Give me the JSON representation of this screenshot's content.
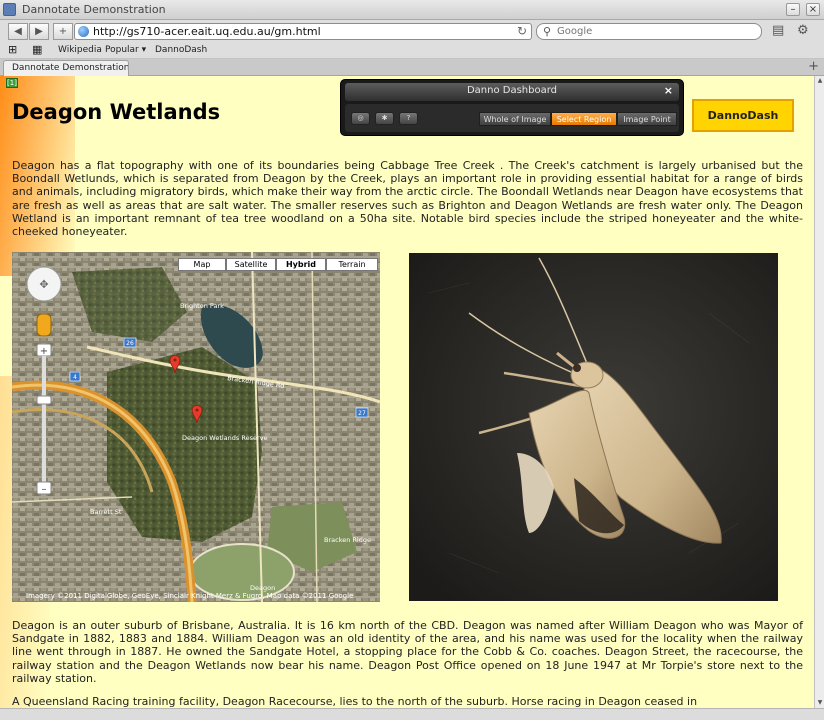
{
  "window": {
    "title": "Dannotate Demonstration"
  },
  "toolbar": {
    "back": "◀",
    "forward": "▶",
    "add": "+",
    "url": "http://gs710-acer.eait.uq.edu.au/gm.html",
    "reload": "↻",
    "search_placeholder": "Google"
  },
  "bookmarks": {
    "items": [
      "Wikipedia",
      "Popular ▾",
      "DannoDash"
    ]
  },
  "tab": {
    "label": "Dannotate Demonstration"
  },
  "page": {
    "badge": "[1]",
    "heading": "Deagon Wetlands",
    "para1": "Deagon has a flat topography with one of its boundaries being Cabbage Tree Creek . The Creek's catchment is largely urbanised but the Boondall Wetlunds, which is separated from Deagon by the Creek, plays an important role in providing essential habitat for a range of birds and animals, including migratory birds, which make their way from the arctic circle. The Boondall Wetlands near Deagon have ecosystems that are fresh as well as areas that are salt water. The smaller reserves such as Brighton and Deagon Wetlands are fresh water only. The Deagon Wetland is an important remnant of tea tree woodland on a 50ha site. Notable bird species include the striped honeyeater and the white-cheeked honeyeater.",
    "para2": "Deagon is an outer suburb of Brisbane, Australia. It is 16 km north of the CBD. Deagon was named after William Deagon who was Mayor of Sandgate in 1882, 1883 and 1884. William Deagon was an old identity of the area, and his name was used for the locality when the railway line went through in 1887. He owned the Sandgate Hotel, a stopping place for the Cobb & Co. coaches. Deagon Street, the racecourse, the railway station and the Deagon Wetlands now bear his name. Deagon Post Office opened on 18 June 1947 at Mr Torpie's store next to the railway station.",
    "para3": "A Queensland Racing training facility, Deagon Racecourse, lies to the north of the suburb. Horse racing in Deagon ceased in"
  },
  "dashboard": {
    "title": "Danno Dashboard",
    "close": "×",
    "icon_buttons": [
      "◎",
      "✱",
      "?"
    ],
    "modes": [
      "Whole of Image",
      "Select Region",
      "Image Point"
    ],
    "active_mode": "Select Region"
  },
  "dannodash_button": "DannoDash",
  "map": {
    "types": [
      "Map",
      "Satellite",
      "Hybrid",
      "Terrain"
    ],
    "active_type": "Hybrid",
    "labels": {
      "brighton": "Brighton Park",
      "bracken": "Bracken Ridge Rd",
      "wetlands": "Deagon Wetlands Reserve",
      "deagon": "Deagon",
      "route26": "26",
      "route27": "27",
      "route4": "4",
      "barrett": "Barrett St",
      "bracken_ridge": "Bracken Ridge"
    },
    "copyright": "Imagery ©2011 DigitalGlobe, GeoEye, Sinclair Knight Merz & Fugro, Map data ©2011 Google"
  },
  "colors": {
    "page_bg": "#ffffc2",
    "accent_orange": "#ff8d16",
    "active_mode": "#f08a10",
    "dannodash_yellow": "#ffd400"
  }
}
